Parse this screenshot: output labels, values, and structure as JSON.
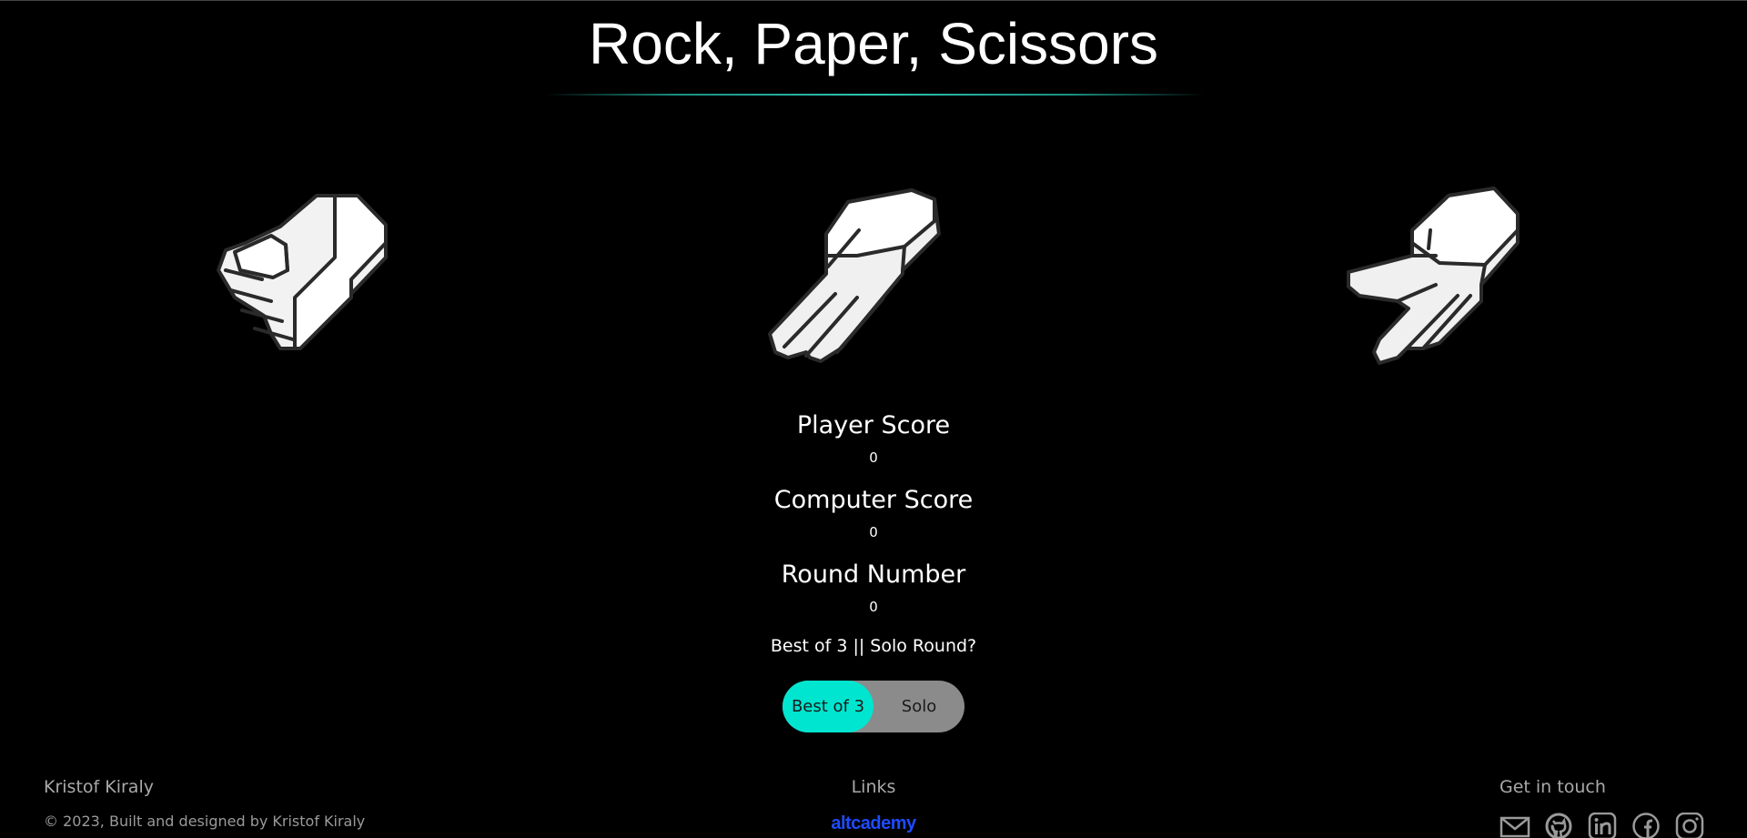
{
  "header": {
    "title": "Rock, Paper, Scissors"
  },
  "choices": [
    {
      "id": "rock",
      "icon": "rock-hand-icon"
    },
    {
      "id": "paper",
      "icon": "paper-hand-icon"
    },
    {
      "id": "scissors",
      "icon": "scissors-hand-icon"
    }
  ],
  "scores": {
    "player_label": "Player Score",
    "player_value": "0",
    "computer_label": "Computer Score",
    "computer_value": "0",
    "round_label": "Round Number",
    "round_value": "0"
  },
  "mode": {
    "question": "Best of 3 || Solo Round?",
    "option_left": "Best of 3",
    "option_right": "Solo",
    "selected": "Best of 3",
    "accent": "#00e5cf"
  },
  "footer": {
    "author": "Kristof Kiraly",
    "copyright": "© 2023, Built and designed by Kristof Kiraly",
    "links_heading": "Links",
    "brand": "altcademy",
    "contact_heading": "Get in touch",
    "social_icons": [
      "mail-icon",
      "github-icon",
      "linkedin-icon",
      "facebook-icon",
      "instagram-icon"
    ]
  }
}
